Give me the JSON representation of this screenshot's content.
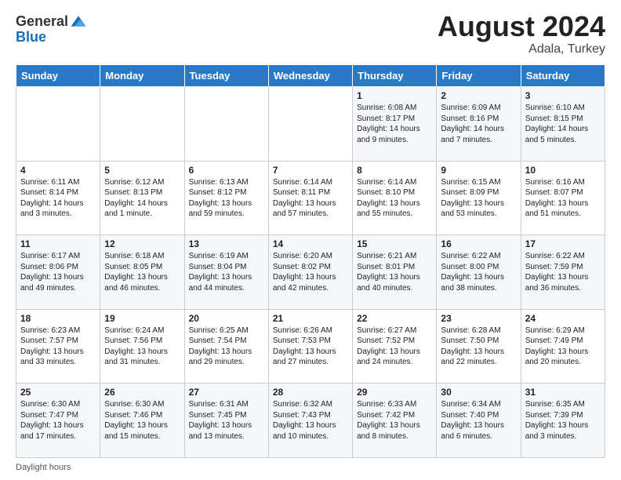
{
  "header": {
    "logo_general": "General",
    "logo_blue": "Blue",
    "month_year": "August 2024",
    "location": "Adala, Turkey"
  },
  "weekdays": [
    "Sunday",
    "Monday",
    "Tuesday",
    "Wednesday",
    "Thursday",
    "Friday",
    "Saturday"
  ],
  "weeks": [
    [
      {
        "day": "",
        "info": ""
      },
      {
        "day": "",
        "info": ""
      },
      {
        "day": "",
        "info": ""
      },
      {
        "day": "",
        "info": ""
      },
      {
        "day": "1",
        "info": "Sunrise: 6:08 AM\nSunset: 8:17 PM\nDaylight: 14 hours\nand 9 minutes."
      },
      {
        "day": "2",
        "info": "Sunrise: 6:09 AM\nSunset: 8:16 PM\nDaylight: 14 hours\nand 7 minutes."
      },
      {
        "day": "3",
        "info": "Sunrise: 6:10 AM\nSunset: 8:15 PM\nDaylight: 14 hours\nand 5 minutes."
      }
    ],
    [
      {
        "day": "4",
        "info": "Sunrise: 6:11 AM\nSunset: 8:14 PM\nDaylight: 14 hours\nand 3 minutes."
      },
      {
        "day": "5",
        "info": "Sunrise: 6:12 AM\nSunset: 8:13 PM\nDaylight: 14 hours\nand 1 minute."
      },
      {
        "day": "6",
        "info": "Sunrise: 6:13 AM\nSunset: 8:12 PM\nDaylight: 13 hours\nand 59 minutes."
      },
      {
        "day": "7",
        "info": "Sunrise: 6:14 AM\nSunset: 8:11 PM\nDaylight: 13 hours\nand 57 minutes."
      },
      {
        "day": "8",
        "info": "Sunrise: 6:14 AM\nSunset: 8:10 PM\nDaylight: 13 hours\nand 55 minutes."
      },
      {
        "day": "9",
        "info": "Sunrise: 6:15 AM\nSunset: 8:09 PM\nDaylight: 13 hours\nand 53 minutes."
      },
      {
        "day": "10",
        "info": "Sunrise: 6:16 AM\nSunset: 8:07 PM\nDaylight: 13 hours\nand 51 minutes."
      }
    ],
    [
      {
        "day": "11",
        "info": "Sunrise: 6:17 AM\nSunset: 8:06 PM\nDaylight: 13 hours\nand 49 minutes."
      },
      {
        "day": "12",
        "info": "Sunrise: 6:18 AM\nSunset: 8:05 PM\nDaylight: 13 hours\nand 46 minutes."
      },
      {
        "day": "13",
        "info": "Sunrise: 6:19 AM\nSunset: 8:04 PM\nDaylight: 13 hours\nand 44 minutes."
      },
      {
        "day": "14",
        "info": "Sunrise: 6:20 AM\nSunset: 8:02 PM\nDaylight: 13 hours\nand 42 minutes."
      },
      {
        "day": "15",
        "info": "Sunrise: 6:21 AM\nSunset: 8:01 PM\nDaylight: 13 hours\nand 40 minutes."
      },
      {
        "day": "16",
        "info": "Sunrise: 6:22 AM\nSunset: 8:00 PM\nDaylight: 13 hours\nand 38 minutes."
      },
      {
        "day": "17",
        "info": "Sunrise: 6:22 AM\nSunset: 7:59 PM\nDaylight: 13 hours\nand 36 minutes."
      }
    ],
    [
      {
        "day": "18",
        "info": "Sunrise: 6:23 AM\nSunset: 7:57 PM\nDaylight: 13 hours\nand 33 minutes."
      },
      {
        "day": "19",
        "info": "Sunrise: 6:24 AM\nSunset: 7:56 PM\nDaylight: 13 hours\nand 31 minutes."
      },
      {
        "day": "20",
        "info": "Sunrise: 6:25 AM\nSunset: 7:54 PM\nDaylight: 13 hours\nand 29 minutes."
      },
      {
        "day": "21",
        "info": "Sunrise: 6:26 AM\nSunset: 7:53 PM\nDaylight: 13 hours\nand 27 minutes."
      },
      {
        "day": "22",
        "info": "Sunrise: 6:27 AM\nSunset: 7:52 PM\nDaylight: 13 hours\nand 24 minutes."
      },
      {
        "day": "23",
        "info": "Sunrise: 6:28 AM\nSunset: 7:50 PM\nDaylight: 13 hours\nand 22 minutes."
      },
      {
        "day": "24",
        "info": "Sunrise: 6:29 AM\nSunset: 7:49 PM\nDaylight: 13 hours\nand 20 minutes."
      }
    ],
    [
      {
        "day": "25",
        "info": "Sunrise: 6:30 AM\nSunset: 7:47 PM\nDaylight: 13 hours\nand 17 minutes."
      },
      {
        "day": "26",
        "info": "Sunrise: 6:30 AM\nSunset: 7:46 PM\nDaylight: 13 hours\nand 15 minutes."
      },
      {
        "day": "27",
        "info": "Sunrise: 6:31 AM\nSunset: 7:45 PM\nDaylight: 13 hours\nand 13 minutes."
      },
      {
        "day": "28",
        "info": "Sunrise: 6:32 AM\nSunset: 7:43 PM\nDaylight: 13 hours\nand 10 minutes."
      },
      {
        "day": "29",
        "info": "Sunrise: 6:33 AM\nSunset: 7:42 PM\nDaylight: 13 hours\nand 8 minutes."
      },
      {
        "day": "30",
        "info": "Sunrise: 6:34 AM\nSunset: 7:40 PM\nDaylight: 13 hours\nand 6 minutes."
      },
      {
        "day": "31",
        "info": "Sunrise: 6:35 AM\nSunset: 7:39 PM\nDaylight: 13 hours\nand 3 minutes."
      }
    ]
  ],
  "footer": {
    "daylight_label": "Daylight hours"
  }
}
